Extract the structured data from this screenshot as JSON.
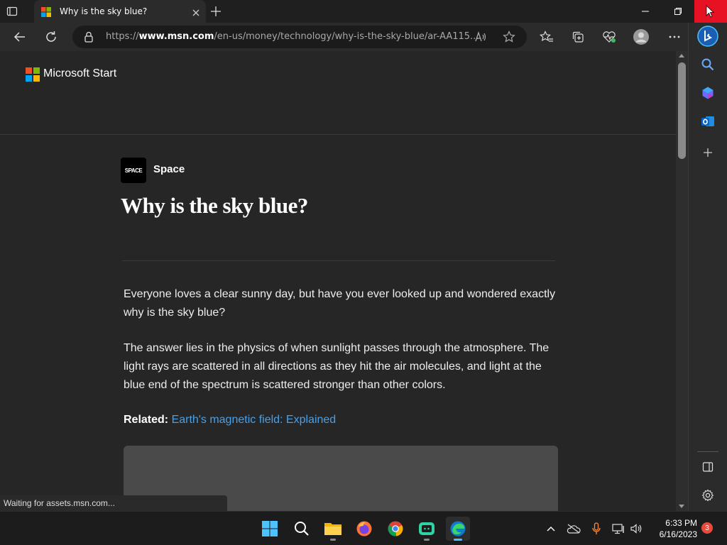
{
  "browser": {
    "tab": {
      "title": "Why is the sky blue?"
    },
    "address": {
      "url_prefix": "https://",
      "url_domain": "www.msn.com",
      "url_path": "/en-us/money/technology/why-is-the-sky-blue/ar-AA115..."
    }
  },
  "page": {
    "brand": "Microsoft Start",
    "source_logo_text": "SPACE",
    "source_name": "Space",
    "title": "Why is the sky blue?",
    "paragraphs": [
      "Everyone loves a clear sunny day, but have you ever looked up and wondered exactly why is the sky blue?",
      "The answer lies in the physics of when sunlight passes through the atmosphere. The light rays are scattered in all directions as they hit the air molecules, and light at the blue end of the spectrum is scattered stronger than other colors."
    ],
    "related_label": "Related:",
    "related_link": "Earth's magnetic field: Explained"
  },
  "status_text": "Waiting for assets.msn.com...",
  "taskbar": {
    "time": "6:33 PM",
    "date": "6/16/2023",
    "notification_count": "3"
  },
  "colors": {
    "accent_link": "#4aa0e6",
    "close_button": "#e81123",
    "edge_blue": "#0c7bd6"
  }
}
